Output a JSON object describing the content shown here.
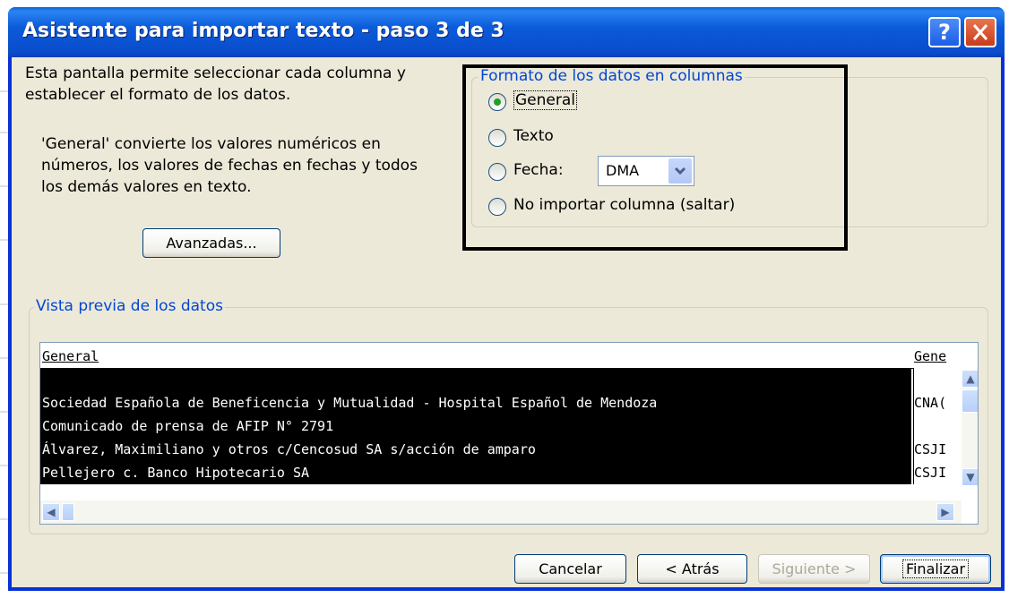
{
  "window": {
    "title": "Asistente para importar texto - paso 3 de 3",
    "help_label": "?"
  },
  "intro": {
    "line1": "Esta pantalla permite seleccionar cada columna y",
    "line2": "establecer el formato de los datos."
  },
  "explanation": {
    "line1": "'General' convierte los valores numéricos en",
    "line2": "números, los valores de fechas en fechas y todos",
    "line3": "los demás valores en texto."
  },
  "advanced_button": "Avanzadas...",
  "format_group": {
    "label": "Formato de los datos en columnas",
    "options": [
      "General",
      "Texto",
      "Fecha:",
      "No importar columna (saltar)"
    ],
    "selected": "General",
    "date_format": "DMA"
  },
  "preview": {
    "label": "Vista previa de los datos",
    "header_col1": "General",
    "header_col2": "Gene",
    "rows_col1": [
      "",
      "Sociedad Española de Beneficencia y Mutualidad - Hospital Español de Mendoza",
      "Comunicado de prensa de AFIP N° 2791",
      "Álvarez, Maximiliano y otros c/Cencosud SA s/acción de amparo",
      "Pellejero c. Banco Hipotecario SA"
    ],
    "rows_col2": [
      "",
      "CNA(",
      "",
      "CSJI",
      "CSJI"
    ]
  },
  "buttons": {
    "cancel": "Cancelar",
    "back": "< Atrás",
    "next": "Siguiente >",
    "finish": "Finalizar"
  },
  "colors": {
    "titlebar": "#0a4ccc",
    "dialog_bg": "#ece9d8",
    "group_label": "#0046d5",
    "radio_selected": "#21a121"
  }
}
